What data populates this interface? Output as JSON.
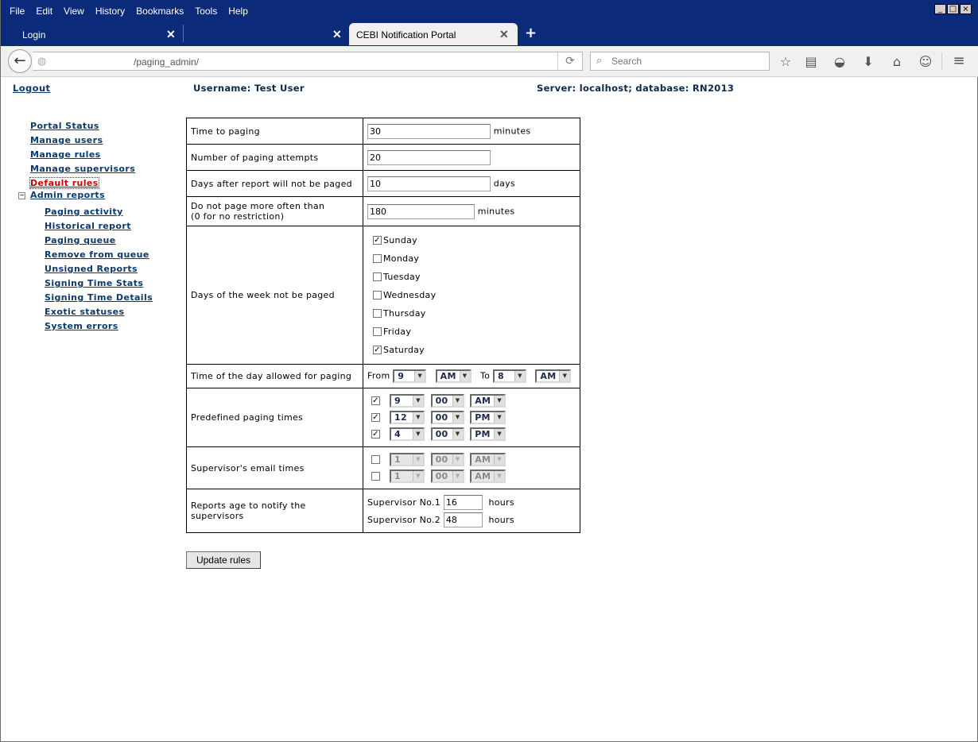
{
  "browser": {
    "menu": [
      "File",
      "Edit",
      "View",
      "History",
      "Bookmarks",
      "Tools",
      "Help"
    ],
    "tabs": [
      {
        "label": "Login",
        "active": false
      },
      {
        "label": "",
        "active": false
      },
      {
        "label": "CEBI Notification Portal",
        "active": true
      }
    ],
    "url": "/paging_admin/",
    "search_placeholder": "Search"
  },
  "header": {
    "logout": "Logout",
    "username": "Username: Test User",
    "server": "Server: localhost; database: RN2013"
  },
  "nav": {
    "items": [
      "Portal Status",
      "Manage users",
      "Manage rules",
      "Manage supervisors",
      "Default rules",
      "Admin reports"
    ],
    "current": "Default rules",
    "sub_items": [
      "Paging activity",
      "Historical report",
      "Paging queue",
      "Remove from queue",
      "Unsigned Reports",
      "Signing Time Stats",
      "Signing Time Details",
      "Exotic statuses",
      "System errors"
    ]
  },
  "rules": {
    "time_to_paging": {
      "label": "Time to paging",
      "value": "30",
      "unit": "minutes"
    },
    "paging_attempts": {
      "label": "Number of paging attempts",
      "value": "20"
    },
    "days_after": {
      "label": "Days after report will not be paged",
      "value": "10",
      "unit": "days"
    },
    "min_interval": {
      "label_line1": "Do not page more often than",
      "label_line2": "(0 for no restriction)",
      "value": "180",
      "unit": "minutes"
    },
    "days_not_paged": {
      "label": "Days of the week not be paged",
      "days": [
        {
          "name": "Sunday",
          "checked": true
        },
        {
          "name": "Monday",
          "checked": false
        },
        {
          "name": "Tuesday",
          "checked": false
        },
        {
          "name": "Wednesday",
          "checked": false
        },
        {
          "name": "Thursday",
          "checked": false
        },
        {
          "name": "Friday",
          "checked": false
        },
        {
          "name": "Saturday",
          "checked": true
        }
      ]
    },
    "allowed_time": {
      "label": "Time of the day allowed for paging",
      "from_label": "From",
      "from_hour": "9",
      "from_ampm": "AM",
      "to_label": "To",
      "to_hour": "8",
      "to_ampm": "AM"
    },
    "predefined_times": {
      "label": "Predefined paging times",
      "rows": [
        {
          "checked": true,
          "hour": "9",
          "minute": "00",
          "ampm": "AM"
        },
        {
          "checked": true,
          "hour": "12",
          "minute": "00",
          "ampm": "PM"
        },
        {
          "checked": true,
          "hour": "4",
          "minute": "00",
          "ampm": "PM"
        }
      ]
    },
    "email_times": {
      "label": "Supervisor's email times",
      "rows": [
        {
          "checked": false,
          "hour": "1",
          "minute": "00",
          "ampm": "AM"
        },
        {
          "checked": false,
          "hour": "1",
          "minute": "00",
          "ampm": "AM"
        }
      ]
    },
    "report_age": {
      "label": "Reports age to notify the supervisors",
      "sup1_label": "Supervisor No.1",
      "sup1_value": "16",
      "sup2_label": "Supervisor No.2",
      "sup2_value": "48",
      "unit": "hours"
    }
  },
  "update_button": "Update rules"
}
